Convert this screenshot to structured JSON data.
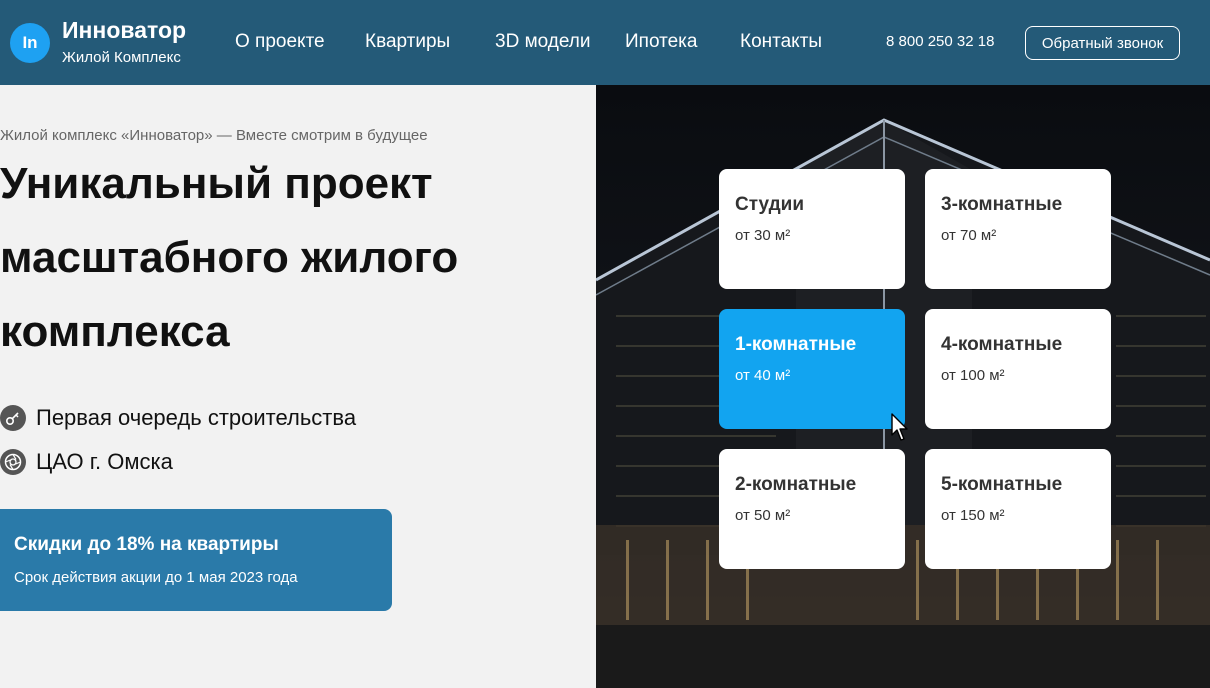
{
  "header": {
    "logo_text": "In",
    "brand_name": "Инноватор",
    "brand_sub": "Жилой Комплекс",
    "nav": [
      "О проекте",
      "Квартиры",
      "3D модели",
      "Ипотека",
      "Контакты"
    ],
    "phone": "8 800 250 32 18",
    "callback_label": "Обратный звонок"
  },
  "hero": {
    "subtitle": "Жилой комплекс «Инноватор» — Вместе смотрим в будущее",
    "headline": "Уникальный проект масштабного жилого комплекса",
    "features": [
      {
        "icon": "key-icon",
        "text": "Первая очередь строительства"
      },
      {
        "icon": "aperture-icon",
        "text": "ЦАО г. Омска"
      }
    ],
    "promo": {
      "title": "Скидки до 18% на квартиры",
      "subtitle": "Срок действия акции до 1 мая 2023 года"
    }
  },
  "apartments": [
    {
      "title": "Студии",
      "area": "от 30 м²"
    },
    {
      "title": "3-комнатные",
      "area": "от 70 м²"
    },
    {
      "title": "1-комнатные",
      "area": "от 40 м²",
      "selected": true
    },
    {
      "title": "4-комнатные",
      "area": "от 100 м²"
    },
    {
      "title": "2-комнатные",
      "area": "от 50 м²"
    },
    {
      "title": "5-комнатные",
      "area": "от 150 м²"
    }
  ],
  "colors": {
    "header_bg": "#245a78",
    "accent_blue": "#12a4f0",
    "promo_bg": "#2a7aa9"
  }
}
